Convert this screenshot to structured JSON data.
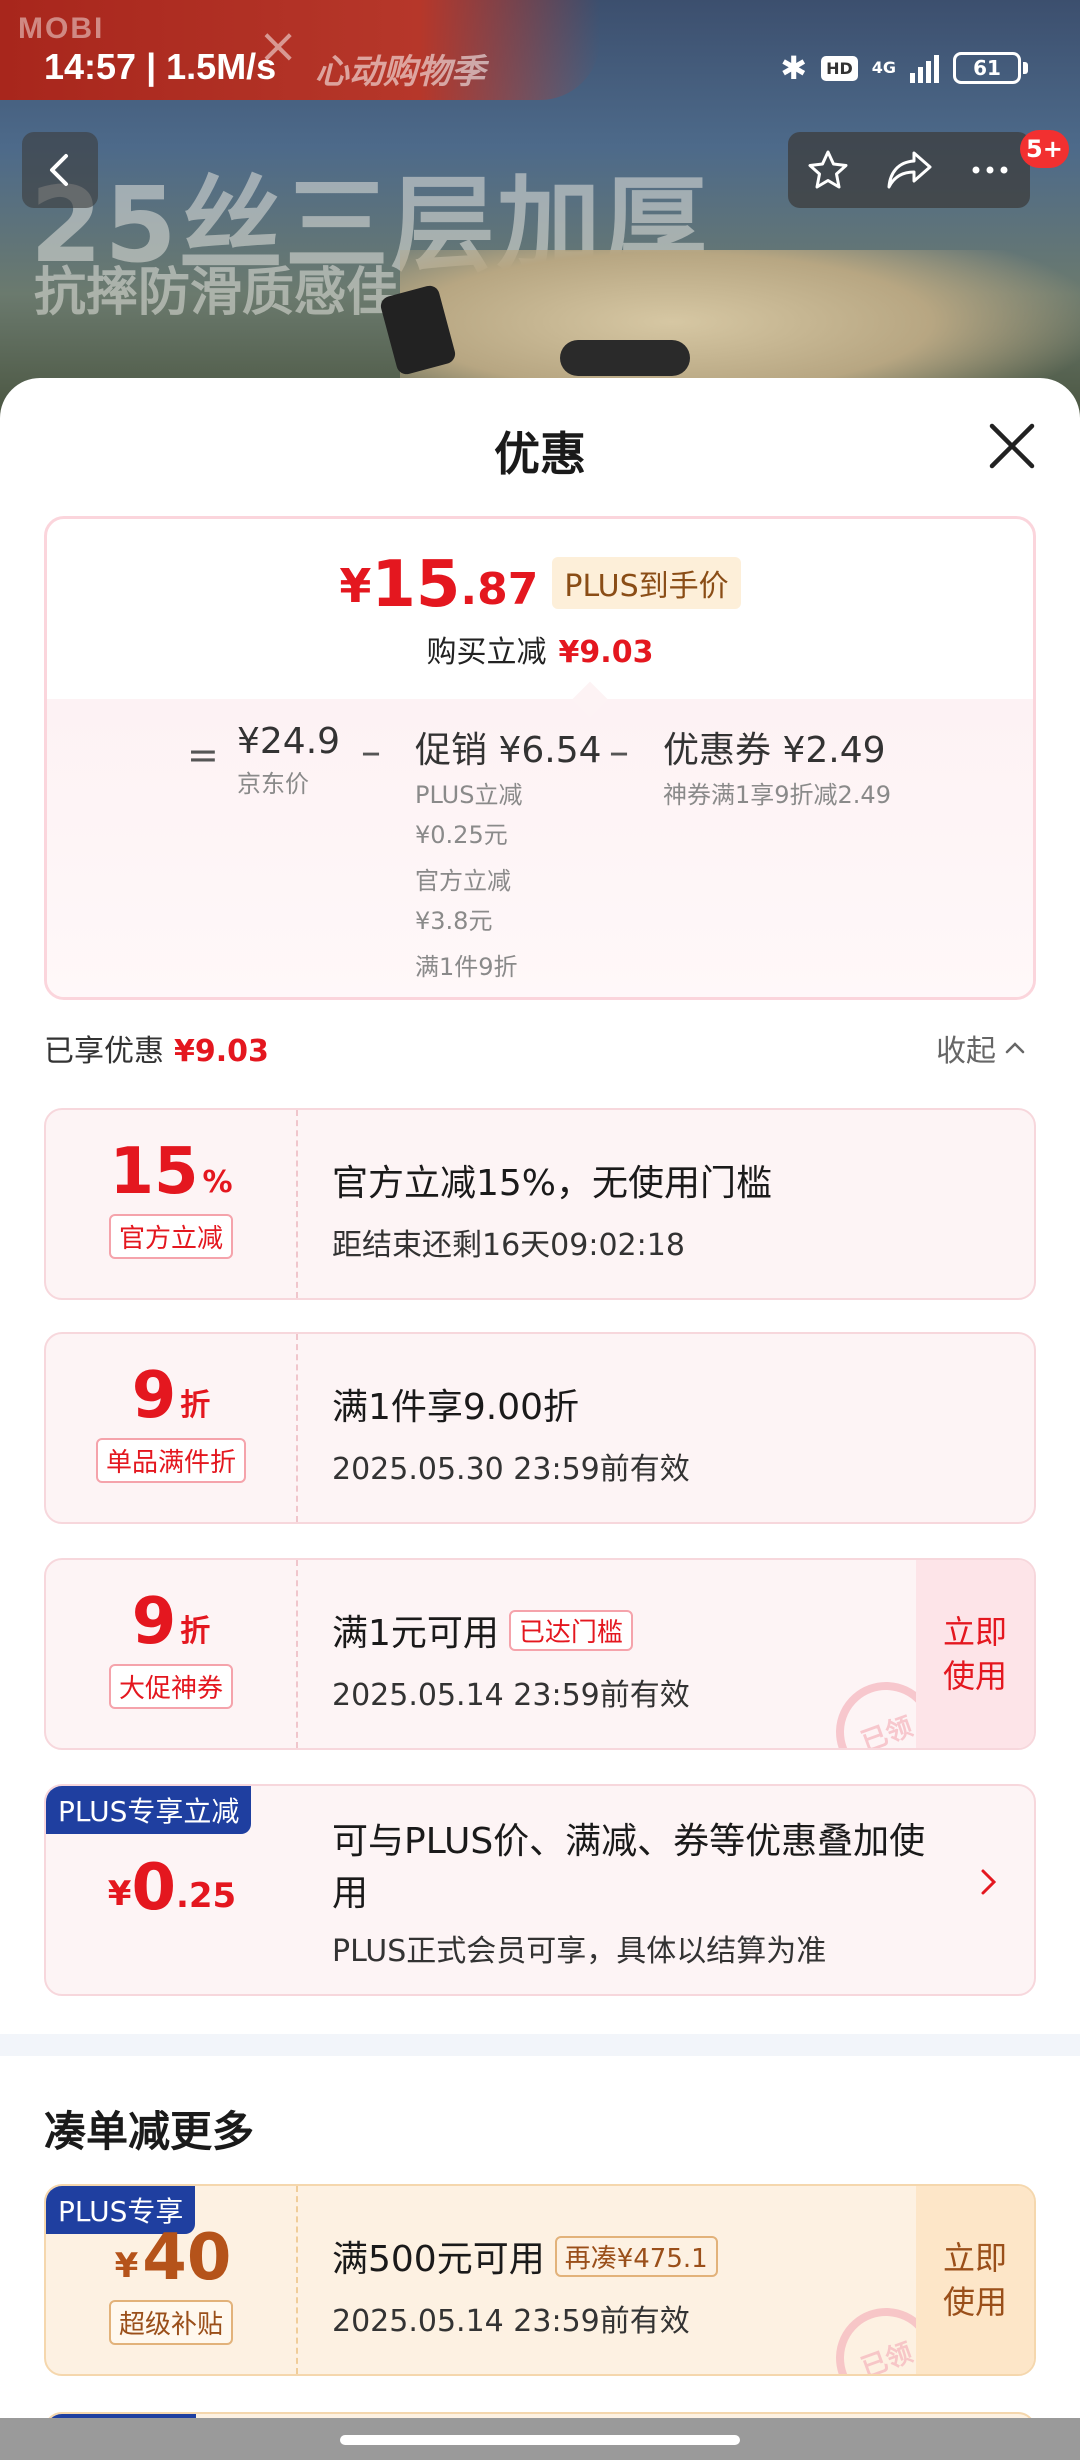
{
  "status": {
    "time": "14:57 | 1.5M/s",
    "network": "4G",
    "hd": "HD",
    "battery": "61"
  },
  "hero": {
    "brand": "MOBI",
    "event": "心动购物季",
    "headline": "25丝三层加厚",
    "subline": "抗摔防滑质感佳"
  },
  "nav": {
    "back_icon": "chevron-left-icon",
    "badge": "5+"
  },
  "sheet": {
    "title": "优惠",
    "summary": {
      "yen": "¥",
      "price_int": "15",
      "price_dec": ".87",
      "price_tag": "PLUS到手价",
      "cut_label": "购买立减",
      "cut_value": "¥9.03",
      "eq": "=",
      "jd_price": "¥24.9",
      "jd_label": "京东价",
      "promo_main": "促销 ¥6.54",
      "promo_lines": [
        "PLUS立减",
        "¥0.25元",
        "官方立减",
        "¥3.8元",
        "满1件9折"
      ],
      "coupon_main": "优惠券 ¥2.49",
      "coupon_sub": "神券满1享9折减2.49"
    },
    "enjoyed_label": "已享优惠",
    "enjoyed_value": "¥9.03",
    "collapse_label": "收起",
    "coupons": [
      {
        "value": "15",
        "unit": "%",
        "tag": "官方立减",
        "title": "官方立减15%，无使用门槛",
        "sub": "距结束还剩16天09:02:18"
      },
      {
        "value": "9",
        "unit": "折",
        "tag": "单品满件折",
        "title": "满1件享9.00折",
        "sub": "2025.05.30 23:59前有效"
      },
      {
        "value": "9",
        "unit": "折",
        "tag": "大促神券",
        "title": "满1元可用",
        "badge": "已达门槛",
        "sub": "2025.05.14 23:59前有效",
        "action": "立即使用",
        "stamp": "已领"
      }
    ],
    "plus": {
      "label": "PLUS专享立减",
      "yen": "¥",
      "int": "0",
      "dec": ".25",
      "title": "可与PLUS价、满减、券等优惠叠加使用",
      "sub": "PLUS正式会员可享，具体以结算为准"
    },
    "more_title": "凑单减更多",
    "more_coupon": {
      "plus_label": "PLUS专享",
      "yen": "¥",
      "value": "40",
      "tag": "超级补贴",
      "title": "满500元可用",
      "badge": "再凑¥475.1",
      "sub": "2025.05.14 23:59前有效",
      "action": "立即使用",
      "stamp": "已领"
    }
  }
}
